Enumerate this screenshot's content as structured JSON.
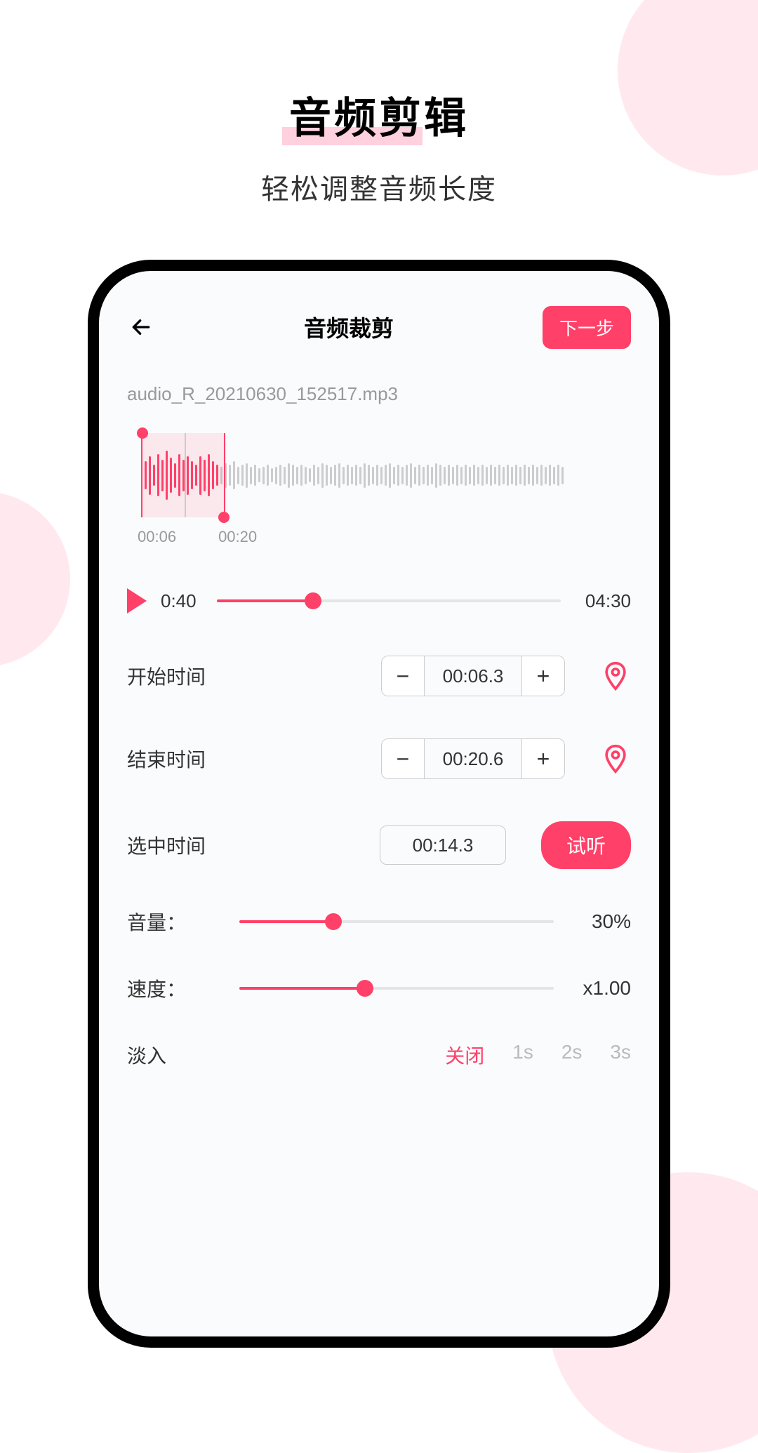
{
  "promo": {
    "title": "音频剪辑",
    "subtitle": "轻松调整音频长度"
  },
  "header": {
    "title": "音频裁剪",
    "next_label": "下一步"
  },
  "filename": "audio_R_20210630_152517.mp3",
  "waveform": {
    "start_label": "00:06",
    "end_label": "00:20"
  },
  "player": {
    "current": "0:40",
    "total": "04:30",
    "progress_pct": 28
  },
  "start_time": {
    "label": "开始时间",
    "value": "00:06.3"
  },
  "end_time": {
    "label": "结束时间",
    "value": "00:20.6"
  },
  "selected_time": {
    "label": "选中时间",
    "value": "00:14.3",
    "preview_label": "试听"
  },
  "volume": {
    "label": "音量：",
    "value": "30%",
    "pct": 30
  },
  "speed": {
    "label": "速度：",
    "value": "x1.00",
    "pct": 40
  },
  "fade_in": {
    "label": "淡入",
    "options": [
      "关闭",
      "1s",
      "2s",
      "3s"
    ],
    "active_index": 0
  },
  "symbols": {
    "minus": "−",
    "plus": "+"
  }
}
